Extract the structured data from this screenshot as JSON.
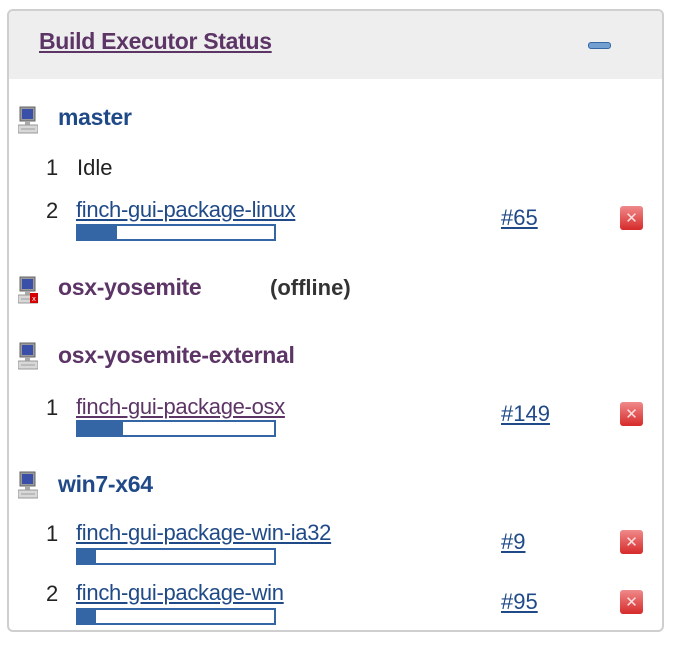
{
  "widget": {
    "title": "Build Executor Status",
    "collapse_icon": "minus-icon"
  },
  "colors": {
    "link": "#204a87",
    "visited_link": "#5c3566",
    "progress": "#3465a4",
    "stop": "#d62a2a"
  },
  "nodes": [
    {
      "name": "master",
      "status": "",
      "executors": [
        {
          "number": "1",
          "idle_text": "Idle"
        },
        {
          "number": "2",
          "job": "finch-gui-package-linux",
          "build": "#65",
          "progress_percent": 20
        }
      ]
    },
    {
      "name": "osx-yosemite",
      "status": "(offline)",
      "executors": []
    },
    {
      "name": "osx-yosemite-external",
      "status": "",
      "executors": [
        {
          "number": "1",
          "job": "finch-gui-package-osx",
          "build": "#149",
          "progress_percent": 23
        }
      ]
    },
    {
      "name": "win7-x64",
      "status": "",
      "executors": [
        {
          "number": "1",
          "job": "finch-gui-package-win-ia32",
          "build": "#9",
          "progress_percent": 9
        },
        {
          "number": "2",
          "job": "finch-gui-package-win",
          "build": "#95",
          "progress_percent": 9
        }
      ]
    }
  ]
}
